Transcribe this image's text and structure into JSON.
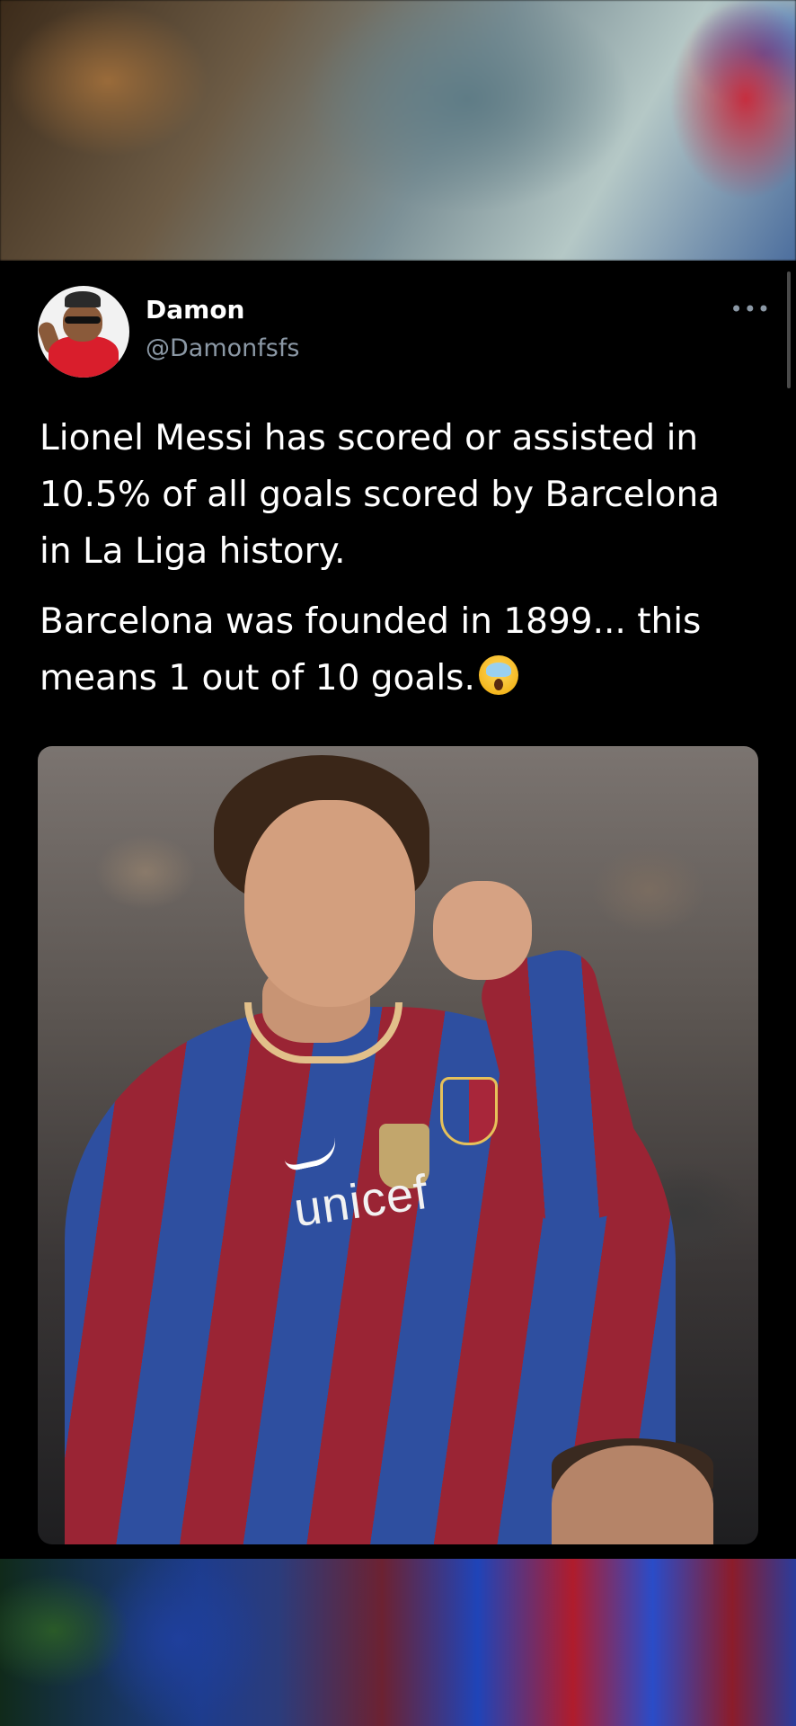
{
  "tweet": {
    "display_name": "Damon",
    "handle": "@Damonfsfs",
    "more_menu_icon": "•••",
    "text_paragraph_1": "Lionel Messi has scored or assisted in 10.5% of all goals scored by Barcelona in La Liga history.",
    "text_paragraph_2": "Barcelona was founded in 1899... this means 1 out of 10 goals.",
    "emoji": "screaming-face-emoji"
  },
  "photo": {
    "sponsor_text": "unicef"
  },
  "colors": {
    "background": "#000000",
    "text_primary": "#ffffff",
    "text_secondary": "#8b98a5"
  }
}
